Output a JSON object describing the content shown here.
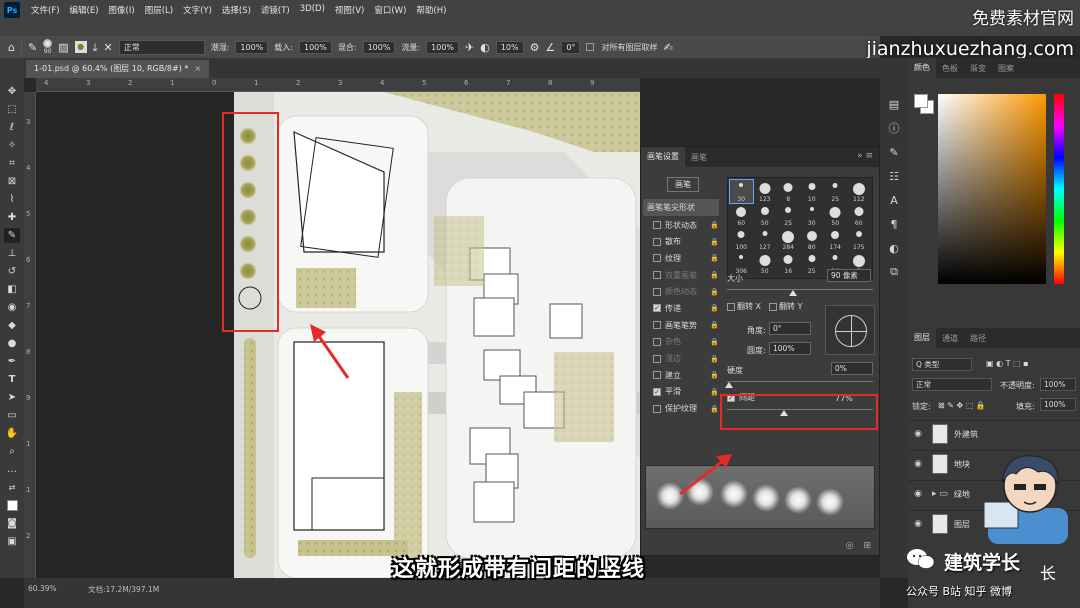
{
  "app": {
    "logo": "Ps",
    "menu": [
      "文件(F)",
      "编辑(E)",
      "图像(I)",
      "图层(L)",
      "文字(Y)",
      "选择(S)",
      "滤镜(T)",
      "3D(D)",
      "视图(V)",
      "窗口(W)",
      "帮助(H)"
    ]
  },
  "options_bar": {
    "brush_size": "90",
    "mode": "正常",
    "opacity_label": "不透明度:",
    "opacity": "100%",
    "flow_label": "流量:",
    "flow": "100%",
    "smoothing_label": "平滑:",
    "smoothing": "10%",
    "angle": "0°",
    "sample_all": "对所有图层取样",
    "extra_label": "载入:",
    "extra_val": "100%",
    "mix_label": "混合:",
    "mix_val": "100%",
    "wet_label": "潮湿:",
    "wet_val": "100%"
  },
  "watermark": {
    "line1": "免费素材官网",
    "line2": "jianzhuxuezhang.com"
  },
  "document": {
    "tab_title": "1-01.psd @ 60.4% (图层 10, RGB/8#) *",
    "zoom": "60.39%",
    "doc_info": "文档:17.2M/397.1M"
  },
  "rulers": {
    "top": [
      "4",
      "3",
      "2",
      "1",
      "0",
      "1",
      "2",
      "3",
      "4",
      "5",
      "6",
      "7",
      "8",
      "9"
    ],
    "left": [
      "3",
      "4",
      "5",
      "6",
      "7",
      "8",
      "9",
      "1",
      "1",
      "2"
    ]
  },
  "brush_panel": {
    "tabs": [
      "画笔设置",
      "画笔"
    ],
    "brushes_button": "画笔",
    "settings": [
      {
        "label": "画笔笔尖形状",
        "checked": false,
        "disabled": false,
        "header": true
      },
      {
        "label": "形状动态",
        "checked": false,
        "disabled": false
      },
      {
        "label": "散布",
        "checked": false,
        "disabled": false
      },
      {
        "label": "纹理",
        "checked": false,
        "disabled": false
      },
      {
        "label": "双重画笔",
        "checked": false,
        "disabled": true
      },
      {
        "label": "颜色动态",
        "checked": false,
        "disabled": true
      },
      {
        "label": "传递",
        "checked": true,
        "disabled": false
      },
      {
        "label": "画笔笔势",
        "checked": false,
        "disabled": false
      },
      {
        "label": "杂色",
        "checked": false,
        "disabled": true
      },
      {
        "label": "湿边",
        "checked": false,
        "disabled": true
      },
      {
        "label": "建立",
        "checked": false,
        "disabled": false
      },
      {
        "label": "平滑",
        "checked": true,
        "disabled": false
      },
      {
        "label": "保护纹理",
        "checked": false,
        "disabled": false
      }
    ],
    "tip_sizes": [
      "30",
      "123",
      "8",
      "10",
      "25",
      "112",
      "60",
      "50",
      "25",
      "30",
      "50",
      "60",
      "100",
      "127",
      "284",
      "80",
      "174",
      "175",
      "306",
      "50",
      "16",
      "25",
      "14",
      "5"
    ],
    "size_label": "大小",
    "size_value": "90 像素",
    "flip_x": "翻转 X",
    "flip_y": "翻转 Y",
    "angle_label": "角度:",
    "angle_value": "0°",
    "roundness_label": "圆度:",
    "roundness_value": "100%",
    "hardness_label": "硬度",
    "hardness_value": "0%",
    "spacing_label": "间距",
    "spacing_value": "77%",
    "spacing_checked": true
  },
  "color_panel": {
    "tabs": [
      "颜色",
      "色板",
      "渐变",
      "图案"
    ]
  },
  "layers_panel": {
    "tabs": [
      "图层",
      "通道",
      "路径"
    ],
    "filter": "Q 类型",
    "blend_mode": "正常",
    "opacity_label": "不透明度:",
    "opacity": "100%",
    "lock_label": "锁定:",
    "fill_label": "填充:",
    "fill": "100%",
    "layers": [
      {
        "name": "外建筑",
        "type": "layer"
      },
      {
        "name": "地块",
        "type": "layer"
      },
      {
        "name": "绿地",
        "type": "folder"
      },
      {
        "name": "图层",
        "type": "layer"
      }
    ]
  },
  "subtitle": "这就形成带有间距的竖线",
  "branding": {
    "name": "建筑学长",
    "tail": "长",
    "platforms": "公众号  B站  知乎  微博"
  },
  "colors": {
    "accent_red": "#e52a2a",
    "menu_bg": "#424242",
    "panel_bg": "#3c3c3c"
  }
}
